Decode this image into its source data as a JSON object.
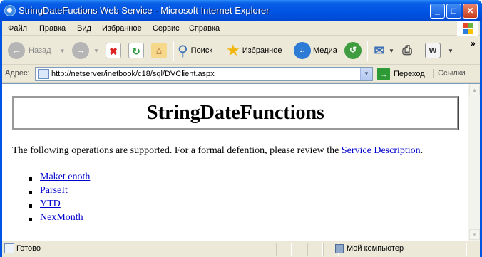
{
  "window": {
    "title": "StringDateFuctions Web Service - Microsoft Internet Explorer",
    "minimize_glyph": "_",
    "maximize_glyph": "□",
    "close_glyph": "✕"
  },
  "menu": {
    "items": [
      {
        "label": "Файл",
        "underline": "Ф"
      },
      {
        "label": "Правка",
        "underline": "П"
      },
      {
        "label": "Вид",
        "underline": "В"
      },
      {
        "label": "Избранное",
        "underline": "И"
      },
      {
        "label": "Сервис",
        "underline": "С"
      },
      {
        "label": "Справка",
        "underline": "С"
      }
    ]
  },
  "toolbar": {
    "back_label": "Назад",
    "search_label": "Поиск",
    "favorites_label": "Избранное",
    "media_label": "Медиа",
    "more_glyph": "»"
  },
  "address": {
    "label": "Адрес:",
    "url": "http://netserver/inetbook/c18/sql/DVClient.aspx",
    "go_label": "Переход",
    "links_label": "Ссылки"
  },
  "page": {
    "heading": "StringDateFunctions",
    "intro_text": "The following operations are supported. For a formal defention, please review the ",
    "service_link": "Service Description",
    "intro_end": ".",
    "operations": [
      "Maket enoth",
      "ParseIt",
      "YTD",
      "NexMonth"
    ]
  },
  "status": {
    "left_text": "Готово",
    "zone_text": "Мой компьютер"
  },
  "colors": {
    "titlebar": "#0054e3",
    "link": "#0000cc",
    "chrome": "#ece9d8"
  }
}
